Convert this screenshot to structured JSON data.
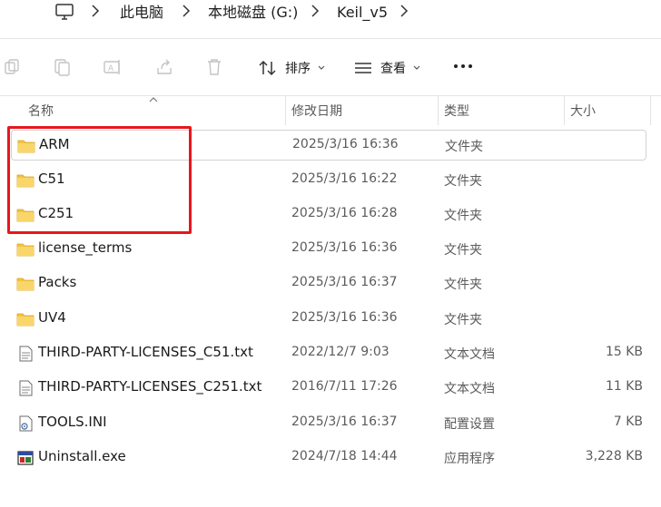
{
  "breadcrumb": {
    "items": [
      "此电脑",
      "本地磁盘 (G:)",
      "Keil_v5"
    ]
  },
  "toolbar": {
    "sort_label": "排序",
    "view_label": "查看"
  },
  "columns": {
    "name": "名称",
    "date": "修改日期",
    "type": "类型",
    "size": "大小"
  },
  "files": [
    {
      "name": "ARM",
      "date": "2025/3/16 16:36",
      "type": "文件夹",
      "size": "",
      "icon": "folder-icon"
    },
    {
      "name": "C51",
      "date": "2025/3/16 16:22",
      "type": "文件夹",
      "size": "",
      "icon": "folder-icon"
    },
    {
      "name": "C251",
      "date": "2025/3/16 16:28",
      "type": "文件夹",
      "size": "",
      "icon": "folder-icon"
    },
    {
      "name": "license_terms",
      "date": "2025/3/16 16:36",
      "type": "文件夹",
      "size": "",
      "icon": "folder-icon"
    },
    {
      "name": "Packs",
      "date": "2025/3/16 16:37",
      "type": "文件夹",
      "size": "",
      "icon": "folder-icon"
    },
    {
      "name": "UV4",
      "date": "2025/3/16 16:36",
      "type": "文件夹",
      "size": "",
      "icon": "folder-icon"
    },
    {
      "name": "THIRD-PARTY-LICENSES_C51.txt",
      "date": "2022/12/7 9:03",
      "type": "文本文档",
      "size": "15 KB",
      "icon": "text-file-icon"
    },
    {
      "name": "THIRD-PARTY-LICENSES_C251.txt",
      "date": "2016/7/11 17:26",
      "type": "文本文档",
      "size": "11 KB",
      "icon": "text-file-icon"
    },
    {
      "name": "TOOLS.INI",
      "date": "2025/3/16 16:37",
      "type": "配置设置",
      "size": "7 KB",
      "icon": "settings-file-icon"
    },
    {
      "name": "Uninstall.exe",
      "date": "2024/7/18 14:44",
      "type": "应用程序",
      "size": "3,228 KB",
      "icon": "exe-file-icon"
    }
  ],
  "colors": {
    "folder": "#f4c343",
    "highlight": "#e8161c",
    "accent": "#0067c0"
  }
}
